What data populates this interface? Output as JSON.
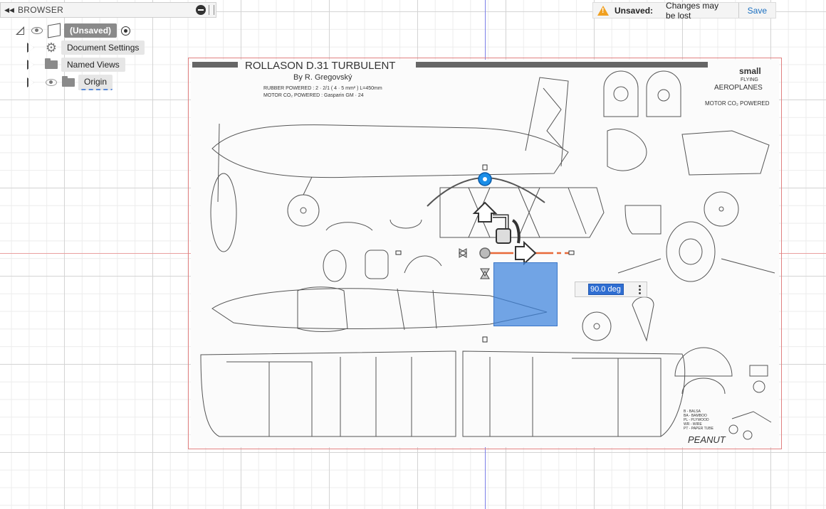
{
  "browser": {
    "title": "BROWSER",
    "root": {
      "label": "(Unsaved)"
    },
    "items": [
      {
        "label": "Document Settings",
        "icon": "gear-icon"
      },
      {
        "label": "Named Views",
        "icon": "folder-icon"
      },
      {
        "label": "Origin",
        "icon": "folder-icon"
      }
    ]
  },
  "unsaved": {
    "label": "Unsaved:",
    "message": "Changes may be lost",
    "save": "Save"
  },
  "canvas": {
    "angle_value": "90.0 deg",
    "blueprint": {
      "title": "ROLLASON D.31 TURBULENT",
      "author": "By  R. Gregovský",
      "spec1": "RUBBER POWERED : 2 · 2/1 ( 4 · 5 mm² ) L=450mm",
      "spec2": "MOTOR CO₂ POWERED : Gasparin  GM · 24",
      "logo1": "small",
      "logo2": "FLYING",
      "logo3": "AEROPLANES",
      "motor_label": "MOTOR CO₂ POWERED",
      "peanut": "PEANUT",
      "legend": [
        "B  - BALSA",
        "BA - BAMBOO",
        "PL - PLYWOOD",
        "WR - WIRE",
        "PT - PAPER TUBE"
      ]
    }
  },
  "colors": {
    "accent": "#1a6fc0",
    "selection": "#3c82dc",
    "warning": "#f0a020"
  }
}
